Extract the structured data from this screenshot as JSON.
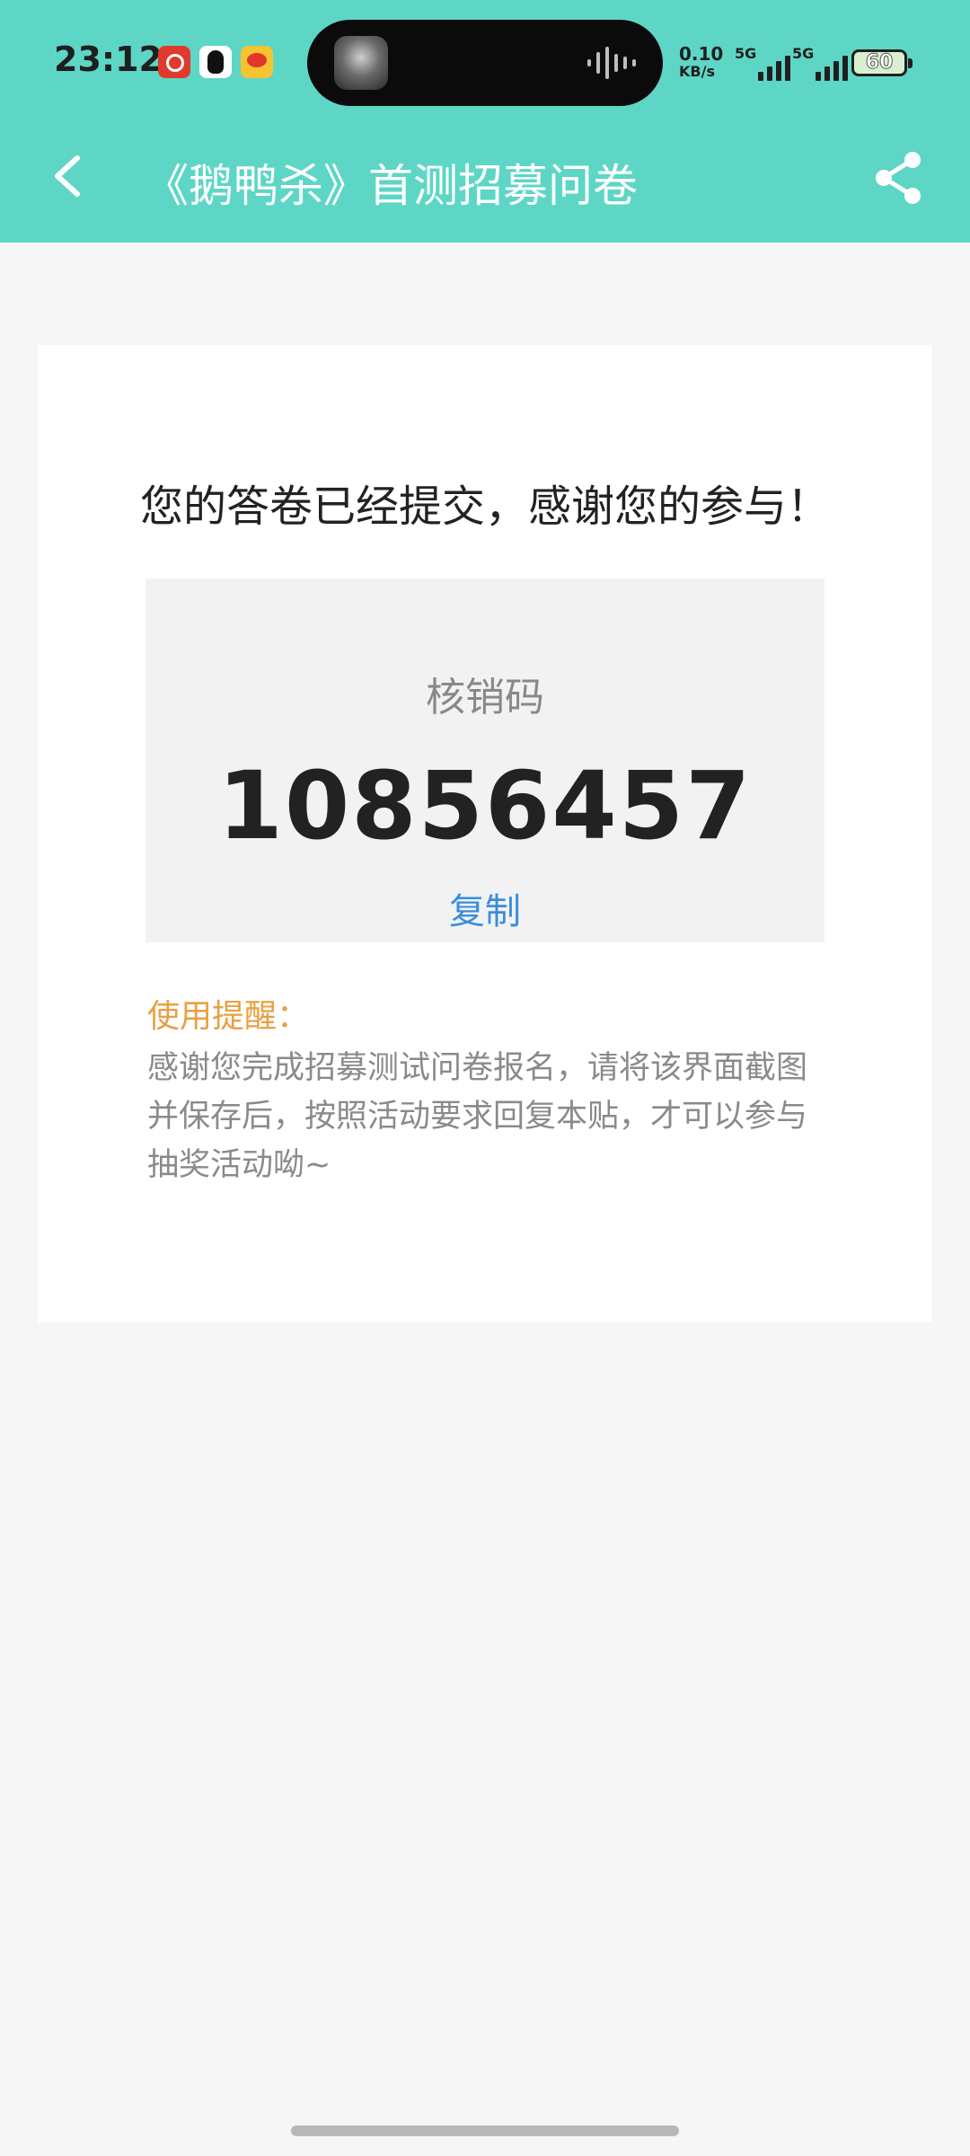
{
  "status_bar": {
    "time": "23:12",
    "net_speed_value": "0.10",
    "net_speed_unit": "KB/s",
    "signal1_label": "5G",
    "signal2_label": "5G",
    "battery_level": "60"
  },
  "nav": {
    "title": "《鹅鸭杀》首测招募问卷"
  },
  "card": {
    "success_message": "您的答卷已经提交，感谢您的参与！",
    "code_label": "核销码",
    "code_value": "10856457",
    "copy_label": "复制",
    "reminder_title": "使用提醒：",
    "reminder_text": "感谢您完成招募测试问卷报名，请将该界面截图并保存后，按照活动要求回复本贴，才可以参与抽奖活动呦~"
  },
  "colors": {
    "header_bg": "#5ed6c5",
    "link": "#3a8ddb",
    "reminder_accent": "#e8a043"
  }
}
